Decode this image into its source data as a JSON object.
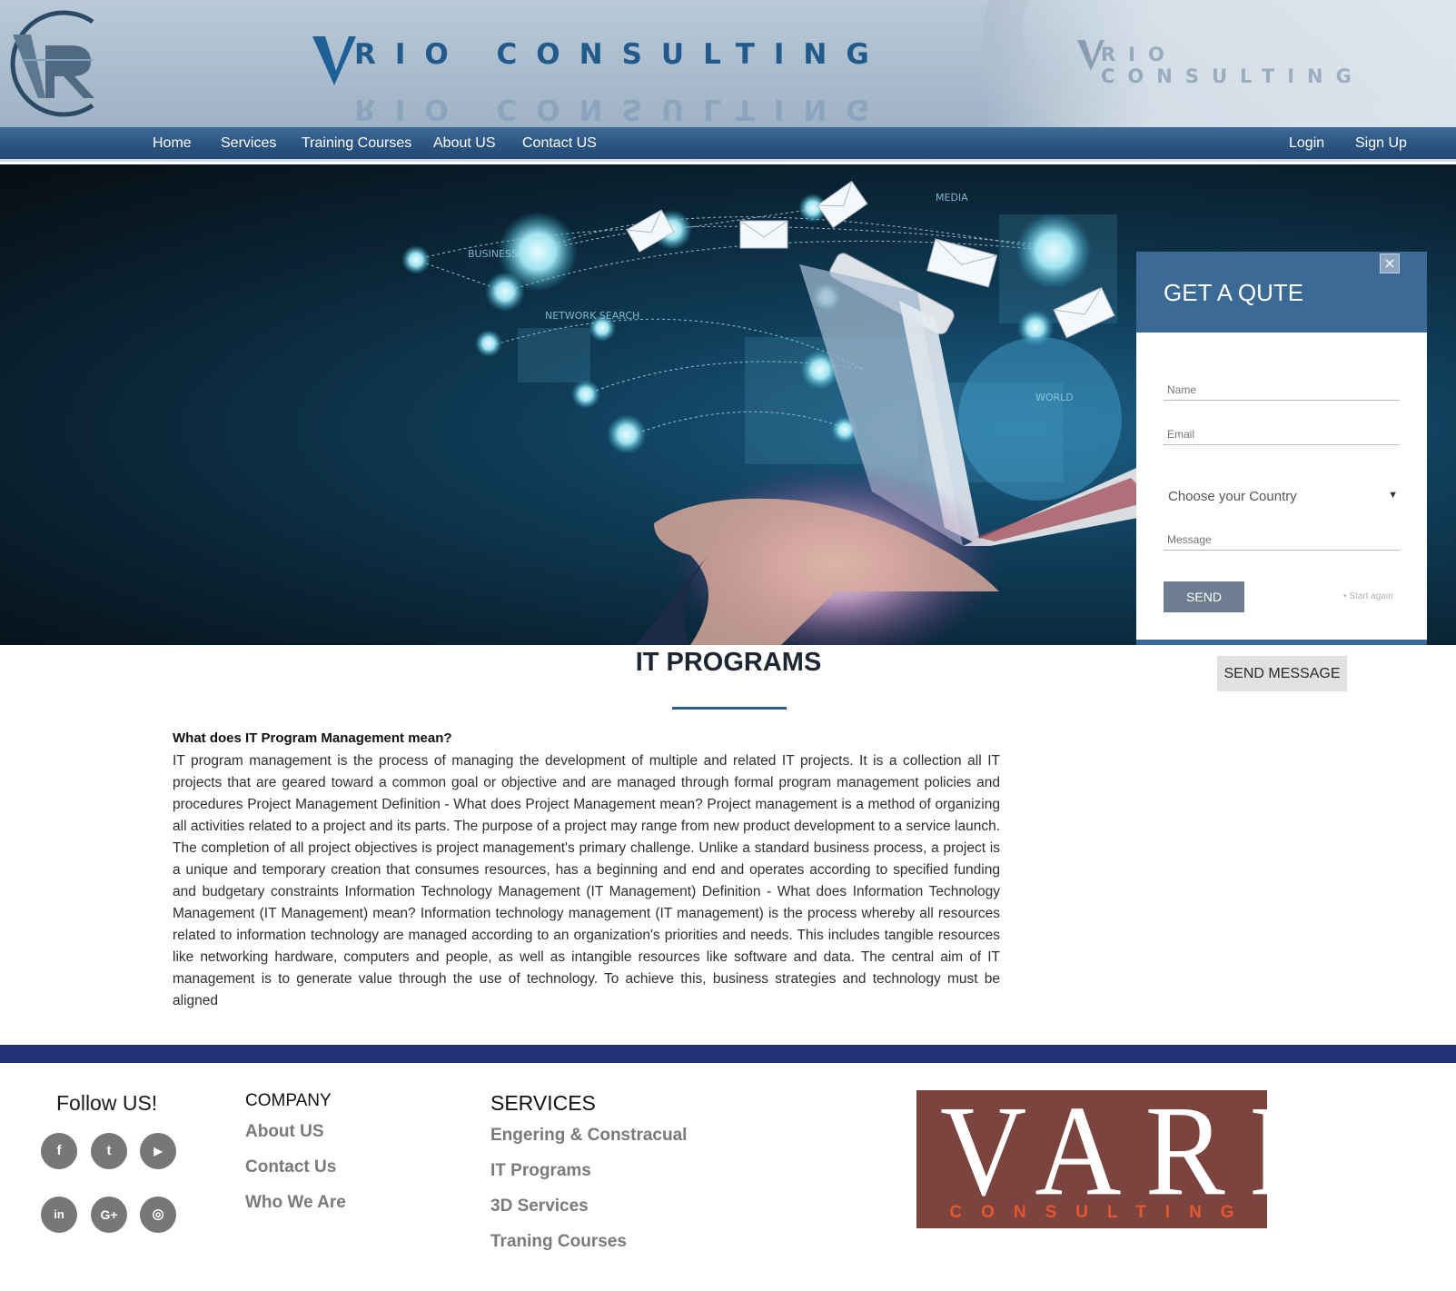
{
  "header": {
    "brand_name": "RIO CONSULTING",
    "ghost_brand_name": "RIO CONSULTING"
  },
  "nav": {
    "left": [
      "Home",
      "Services",
      "Training Courses",
      "About US",
      "Contact US"
    ],
    "right": [
      "Login",
      "Sign Up"
    ]
  },
  "quote_form": {
    "title": "GET A QUTE",
    "close_icon": "×",
    "name_placeholder": "Name",
    "email_placeholder": "Email",
    "country_select": "Choose your Country",
    "message_placeholder": "Message",
    "send_label": "SEND",
    "start_again": "• Start again"
  },
  "content": {
    "title": "IT PROGRAMS",
    "send_message": "SEND MESSAGE",
    "question": "What does IT Program Management mean?",
    "body": "IT program management is the process of managing the development of multiple and related IT projects. It is a collection all IT projects that are geared toward a common goal or objective and are managed through formal program management policies and procedures Project Management Definition - What does Project Management mean? Project management is a method of organizing all activities related to a project and its parts. The purpose of a project may range from new product development to a service launch. The completion of all project objectives is project management's primary challenge. Unlike a standard business process, a project is a unique and temporary creation that consumes resources, has a beginning and end and operates according to specified funding and budgetary constraints Information Technology Management (IT Management) Definition - What does Information Technology Management (IT Management) mean? Information technology management (IT management) is the process whereby all resources related to information technology are managed according to an organization's priorities and needs. This includes tangible resources like networking hardware, computers and people, as well as intangible resources like software and data. The central aim of IT management is to generate value through the use of technology. To achieve this, business strategies and technology must be aligned"
  },
  "footer": {
    "follow_label": "Follow US!",
    "social": [
      {
        "icon": "facebook-icon",
        "glyph": "f"
      },
      {
        "icon": "twitter-icon",
        "glyph": "t"
      },
      {
        "icon": "youtube-icon",
        "glyph": "▶"
      },
      {
        "icon": "linkedin-icon",
        "glyph": "in"
      },
      {
        "icon": "google-plus-icon",
        "glyph": "G+"
      },
      {
        "icon": "instagram-icon",
        "glyph": "◎"
      }
    ],
    "company": {
      "heading": "COMPANY",
      "links": [
        "About US",
        "Contact Us",
        "Who We Are"
      ]
    },
    "services": {
      "heading": "SERVICES",
      "links": [
        "Engering & Constracual",
        "IT Programs",
        "3D Services",
        "Traning Courses"
      ]
    },
    "logo": {
      "big": "VARIO",
      "small": "CONSULTING"
    }
  },
  "colors": {
    "nav": "#2c5481",
    "quote_header": "#3b6a97",
    "footer_bar": "#213175",
    "logo_bg": "#7b443e",
    "logo_accent": "#e8552f"
  }
}
